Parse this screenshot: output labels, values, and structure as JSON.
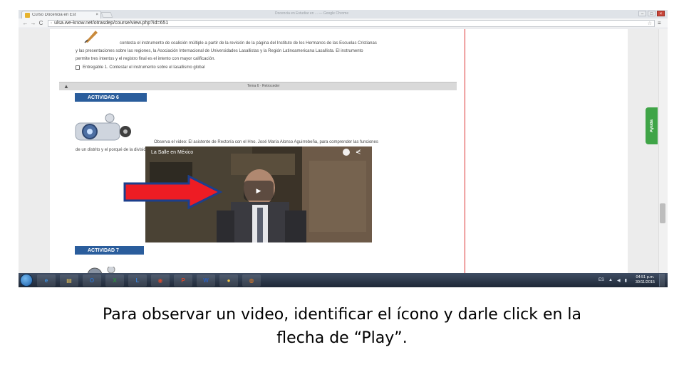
{
  "browser": {
    "tab_title": "Curso Docencia en Est",
    "tab_close": "×",
    "window_title": "Docencia en Estudiar en ... — Google Chrome",
    "window_controls": {
      "minimize": "–",
      "maximize": "□",
      "close": "×"
    },
    "nav": {
      "back": "←",
      "forward": "→",
      "reload": "C"
    },
    "url": "ulsa.we-know.net/otrasdep/course/view.php?id=651",
    "star": "☆",
    "menu": "≡"
  },
  "course": {
    "intro_lines": [
      "contesta el instrumento de coalición múltiple a partir de la revisión de la página del Instituto de los Hermanos de las Escuelas Cristianas",
      "y las presentaciones sobre las regiones, la Asociación Internacional de Universidades Lasallistas y la Región Latinoamericana Lasallista. El instrumento",
      "permite tres intentos y el registro final es el intento con mayor calificación."
    ],
    "deliverable": "Entregable 1. Contestar el instrumento sobre el lasallismo global",
    "toggle_label": "Tema 6 · Retroceder",
    "activity6": "ACTIVIDAD 6",
    "activity6_lines": [
      "Observa el video: El asistente de Rectoría con el Hno. José María Alonso Aguirrebeña, para comprender las funciones",
      "de un distrito y el porqué de la división en nuestro país."
    ],
    "video_title": "La Salle en México",
    "video_share": "⋞",
    "play": "▶",
    "activity7": "ACTIVIDAD 7",
    "help": "Ayuda"
  },
  "taskbar": {
    "apps": [
      {
        "label": "e",
        "color": "#3a8fe0"
      },
      {
        "label": "▤",
        "color": "#e8c45a"
      },
      {
        "label": "O",
        "color": "#2f6ec2"
      },
      {
        "label": "X",
        "color": "#2e8b3e"
      },
      {
        "label": "L",
        "color": "#3b7fd1"
      },
      {
        "label": "◉",
        "color": "#d24a2f"
      },
      {
        "label": "P",
        "color": "#d0492e"
      },
      {
        "label": "W",
        "color": "#2b5db8"
      },
      {
        "label": "●",
        "color": "#f2c744"
      },
      {
        "label": "◍",
        "color": "#e67c22"
      }
    ],
    "tray_lang": "ES",
    "tray_arrow": "▲",
    "tray_vol": "◀",
    "tray_net": "▮",
    "time": "04:51 p.m.",
    "date": "30/11/2015"
  },
  "caption": {
    "line1": "Para observar un video, identificar el ícono y darle click en la",
    "line2": "flecha de “Play”."
  }
}
